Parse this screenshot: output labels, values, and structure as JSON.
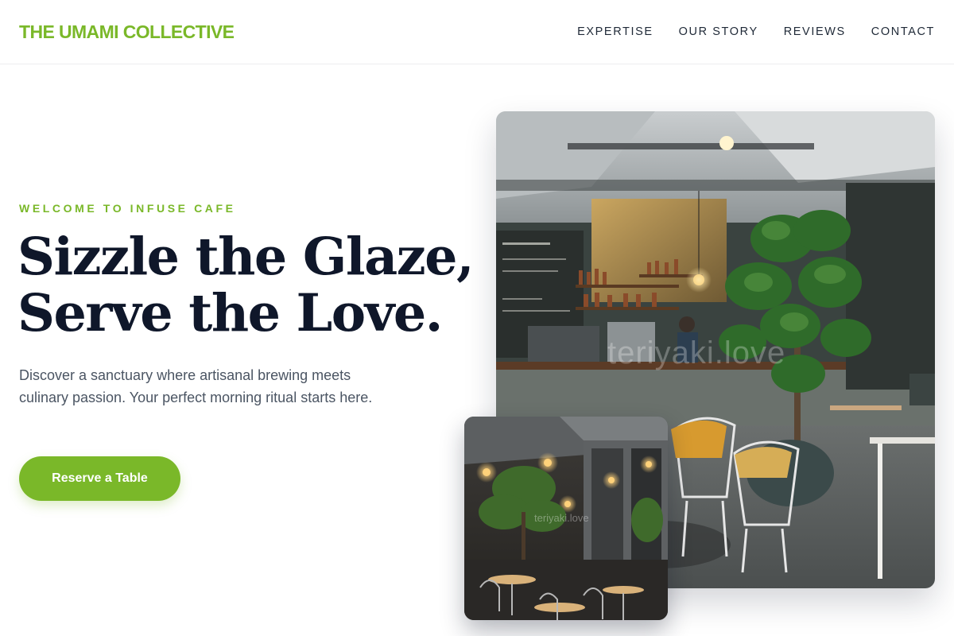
{
  "header": {
    "brand": "THE UMAMI COLLECTIVE",
    "nav": [
      "EXPERTISE",
      "OUR STORY",
      "REVIEWS",
      "CONTACT"
    ]
  },
  "hero": {
    "eyebrow": "WELCOME TO INFUSE CAFE",
    "headline_line1": "Sizzle the Glaze,",
    "headline_line2": "Serve the Love.",
    "description": "Discover a sanctuary where artisanal brewing meets culinary passion. Your perfect morning ritual starts here.",
    "cta_label": "Reserve a Table"
  },
  "images": {
    "main_watermark": "teriyaki.love",
    "small_watermark": "teriyaki.love"
  },
  "colors": {
    "accent": "#7ab829",
    "heading": "#0f172a",
    "body_text": "#4b5563"
  }
}
